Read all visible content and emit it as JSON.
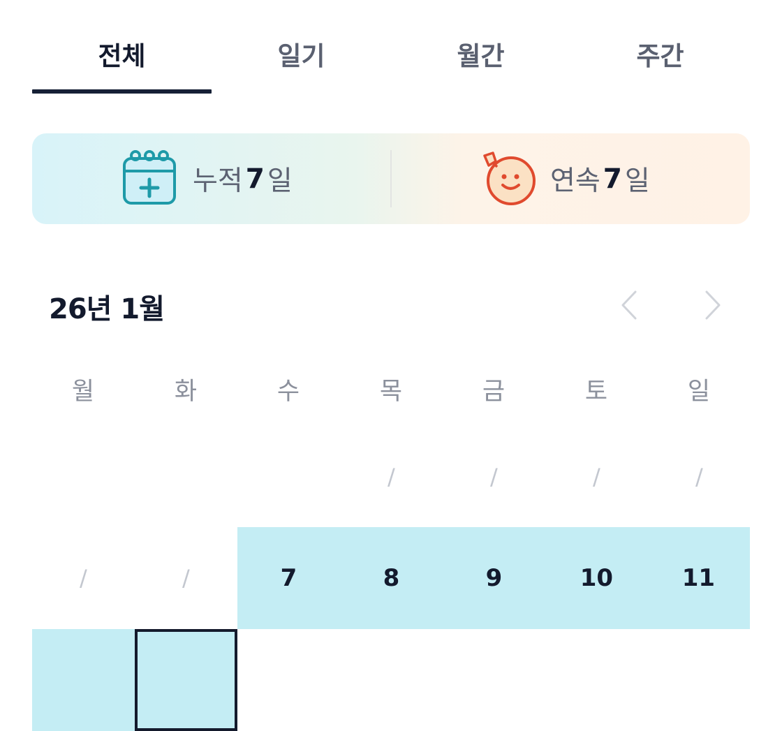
{
  "tabs": [
    {
      "label": "전체",
      "active": true
    },
    {
      "label": "일기",
      "active": false
    },
    {
      "label": "월간",
      "active": false
    },
    {
      "label": "주간",
      "active": false
    }
  ],
  "stats": {
    "cumulative": {
      "label": "누적",
      "value": "7",
      "unit": "일",
      "icon": "calendar-plus-icon"
    },
    "streak": {
      "label": "연속",
      "value": "7",
      "unit": "일",
      "icon": "smiley-face-icon"
    }
  },
  "calendar": {
    "title": "26년 1월",
    "weekdays": [
      "월",
      "화",
      "수",
      "목",
      "금",
      "토",
      "일"
    ],
    "empty_marker": "/",
    "row1": [
      "",
      "",
      "",
      "/",
      "/",
      "/",
      "/"
    ],
    "row2": [
      "/",
      "/",
      "7",
      "8",
      "9",
      "10",
      "11"
    ],
    "row3": [
      "",
      "",
      "",
      "",
      "",
      "",
      ""
    ]
  },
  "colors": {
    "accent": "#162036",
    "logged": "#c4edf4",
    "muted": "#8b909c"
  }
}
